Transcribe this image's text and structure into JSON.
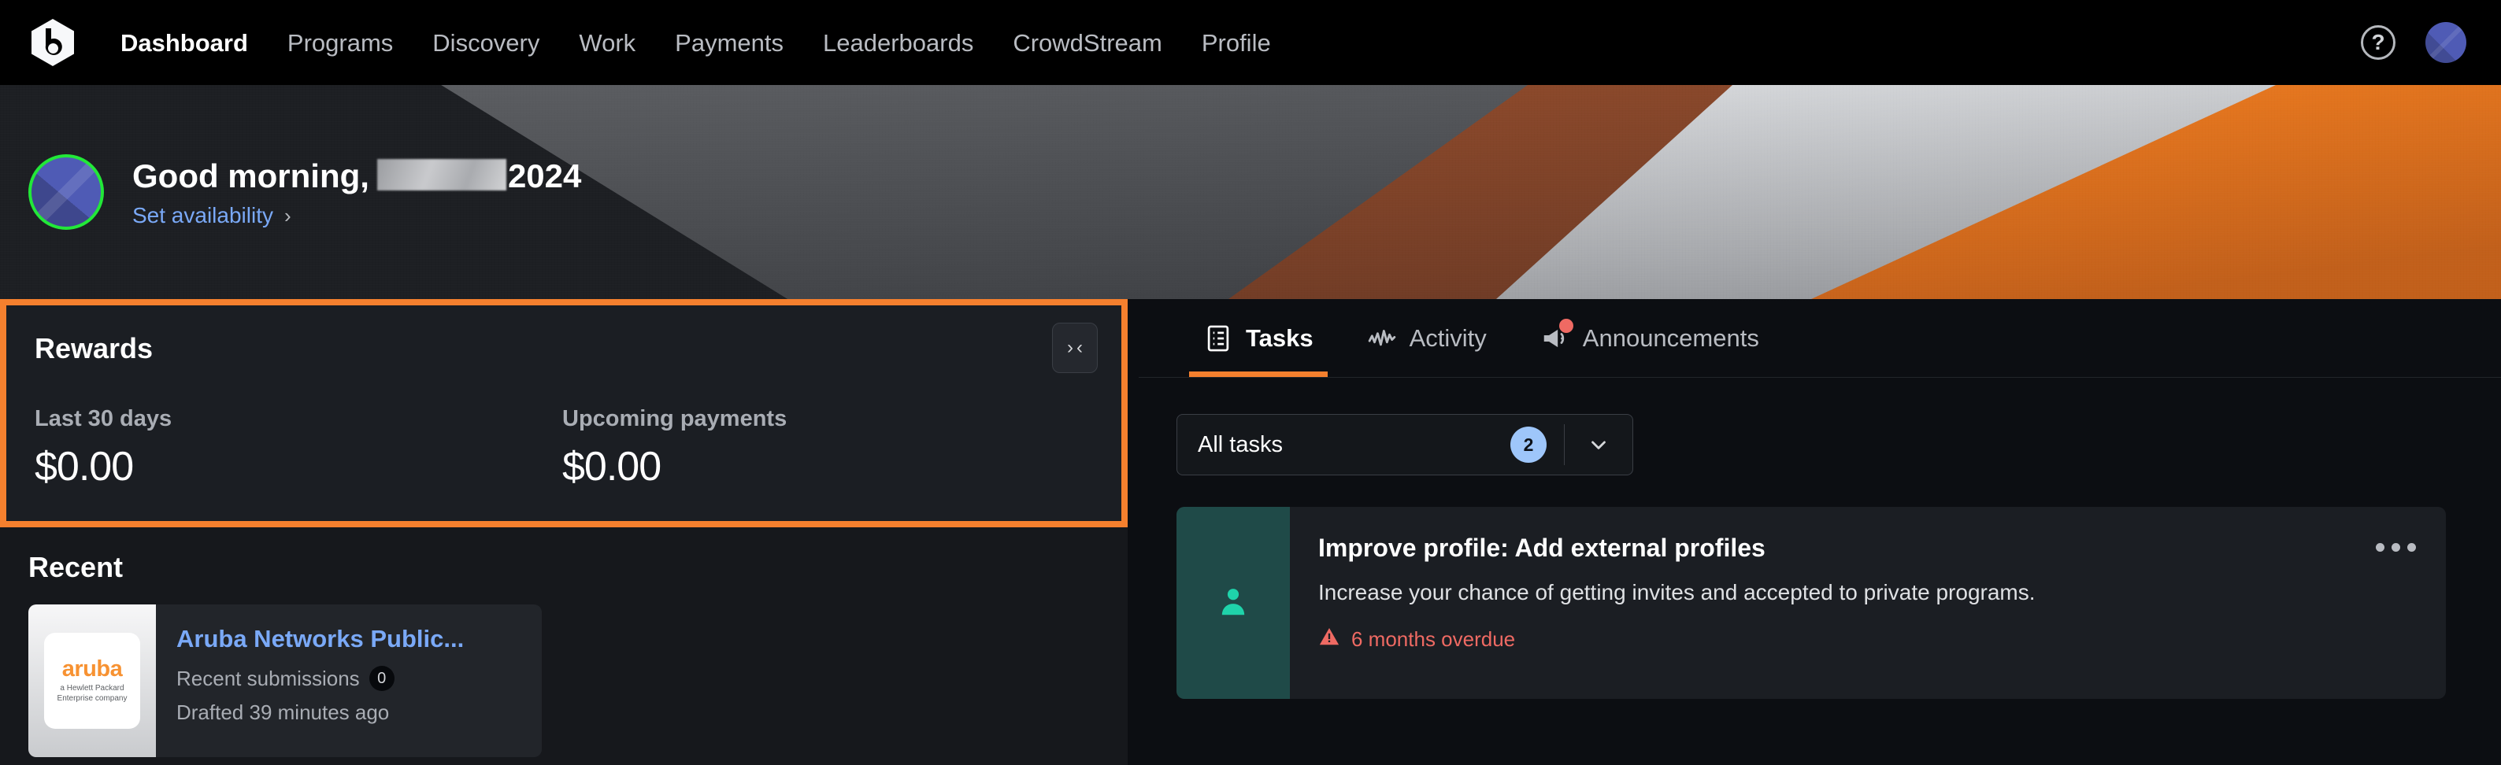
{
  "nav": {
    "logo_icon": "bugcrowd-hexagon-b-logo",
    "links": [
      {
        "label": "Dashboard",
        "active": true
      },
      {
        "label": "Programs",
        "active": false
      },
      {
        "label": "Discovery",
        "active": false
      },
      {
        "label": "Work",
        "active": false
      },
      {
        "label": "Payments",
        "active": false
      },
      {
        "label": "Leaderboards",
        "active": false
      },
      {
        "label": "CrowdStream",
        "active": false
      },
      {
        "label": "Profile",
        "active": false
      }
    ],
    "help_icon": "question-mark-circle-icon",
    "help_glyph": "?",
    "avatar_icon": "user-avatar"
  },
  "hero": {
    "greeting_prefix": "Good morning,",
    "username_redacted": true,
    "username_suffix": "2024",
    "availability_label": "Set availability",
    "availability_chevron": "›",
    "avatar_ring_color": "#22e838"
  },
  "rewards": {
    "title": "Rewards",
    "collapse_icon": "collapse-inward-icon",
    "collapse_left_glyph": "›",
    "collapse_right_glyph": "‹",
    "highlight_color": "#f5802e",
    "stats": [
      {
        "label": "Last 30 days",
        "value": "$0.00"
      },
      {
        "label": "Upcoming payments",
        "value": "$0.00"
      }
    ]
  },
  "recent": {
    "title": "Recent",
    "item": {
      "logo_text": "aruba",
      "logo_subtext": "a Hewlett Packard Enterprise company",
      "name": "Aruba Networks Public...",
      "submissions_label": "Recent submissions",
      "submissions_count": "0",
      "meta": "Drafted 39 minutes ago"
    }
  },
  "panel": {
    "tabs": [
      {
        "label": "Tasks",
        "icon": "list-clipboard-icon",
        "active": true,
        "badge_dot": false
      },
      {
        "label": "Activity",
        "icon": "activity-pulse-icon",
        "active": false,
        "badge_dot": false
      },
      {
        "label": "Announcements",
        "icon": "megaphone-icon",
        "active": false,
        "badge_dot": true
      }
    ],
    "filter": {
      "label": "All tasks",
      "count": "2",
      "caret_icon": "chevron-down-icon"
    },
    "tasks": [
      {
        "icon": "person-profile-icon",
        "title": "Improve profile: Add external profiles",
        "description": "Increase your chance of getting invites and accepted to private programs.",
        "status_icon": "warning-triangle-icon",
        "status": "6 months overdue",
        "menu_icon": "ellipsis-horizontal-icon"
      }
    ]
  }
}
